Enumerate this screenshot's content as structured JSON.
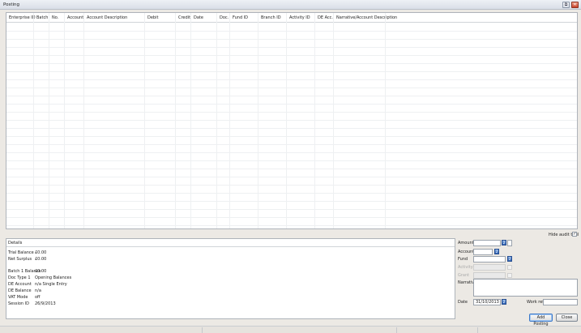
{
  "window": {
    "title": "Posting",
    "controls": {
      "restore": "⧉",
      "close": "✕"
    }
  },
  "grid": {
    "columns": [
      "Enterprise ID",
      "Batch",
      "No.",
      "Account",
      "Account Description",
      "Debit",
      "Credit",
      "Date",
      "Doc.",
      "Fund ID",
      "Branch ID",
      "Activity ID",
      "DE Acc.",
      "Narrative/Account Description"
    ]
  },
  "audit": {
    "label": "Hide audit trail",
    "checked": "✓"
  },
  "details": {
    "header": "Details",
    "rows": [
      {
        "label": "Trial Balance",
        "value": "£0.00"
      },
      {
        "label": "Net Surplus",
        "value": "£0.00"
      },
      {
        "label": "Batch 1 Balance",
        "value": "£0.00"
      },
      {
        "label": "Doc Type 1",
        "value": "Opening Balances"
      },
      {
        "label": "DE Account",
        "value": "n/a Single Entry"
      },
      {
        "label": "DE Balance",
        "value": "n/a"
      },
      {
        "label": "VAT Mode",
        "value": "off"
      },
      {
        "label": "Session ID",
        "value": "26/9/2013"
      }
    ]
  },
  "form": {
    "amount_label": "Amount",
    "amount_value": "",
    "account_label": "Account",
    "fund_label": "Fund",
    "activity_label": "Activity",
    "grant_label": "Grant",
    "narrative_label": "Narrative",
    "date_label": "Date",
    "date_value": "31/10/2013",
    "workref_label": "Work ref.",
    "picker_glyph": "2"
  },
  "buttons": {
    "add_posting": "Add Posting",
    "close": "Close"
  }
}
